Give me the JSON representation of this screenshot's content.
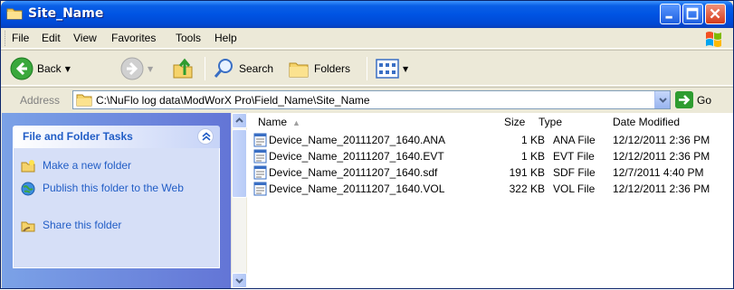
{
  "window": {
    "title": "Site_Name"
  },
  "menu": {
    "items": [
      {
        "label": "File",
        "id": "file"
      },
      {
        "label": "Edit",
        "id": "edit"
      },
      {
        "label": "View",
        "id": "view"
      },
      {
        "label": "Favorites",
        "id": "favorites"
      },
      {
        "label": "Tools",
        "id": "tools"
      },
      {
        "label": "Help",
        "id": "help"
      }
    ]
  },
  "toolbar": {
    "back_label": "Back",
    "search_label": "Search",
    "folders_label": "Folders"
  },
  "address": {
    "label": "Address",
    "path": "C:\\NuFlo log data\\ModWorX Pro\\Field_Name\\Site_Name",
    "go_label": "Go"
  },
  "tasks": {
    "title": "File and Folder Tasks",
    "items": [
      {
        "label": "Make a new folder",
        "icon": "new-folder-icon"
      },
      {
        "label": "Publish this folder to the Web",
        "icon": "globe-icon"
      },
      {
        "label": "Share this folder",
        "icon": "share-folder-icon"
      }
    ]
  },
  "columns": {
    "name": "Name",
    "size": "Size",
    "type": "Type",
    "date": "Date Modified"
  },
  "files": [
    {
      "name": "Device_Name_20111207_1640.ANA",
      "size": "1 KB",
      "type": "ANA File",
      "date": "12/12/2011 2:36 PM"
    },
    {
      "name": "Device_Name_20111207_1640.EVT",
      "size": "1 KB",
      "type": "EVT File",
      "date": "12/12/2011 2:36 PM"
    },
    {
      "name": "Device_Name_20111207_1640.sdf",
      "size": "191 KB",
      "type": "SDF File",
      "date": "12/7/2011 4:40 PM"
    },
    {
      "name": "Device_Name_20111207_1640.VOL",
      "size": "322 KB",
      "type": "VOL File",
      "date": "12/12/2011 2:36 PM"
    }
  ],
  "colors": {
    "titlebar": "#0054e3",
    "task_pane": "#7ba2e7",
    "link": "#215dc6"
  }
}
